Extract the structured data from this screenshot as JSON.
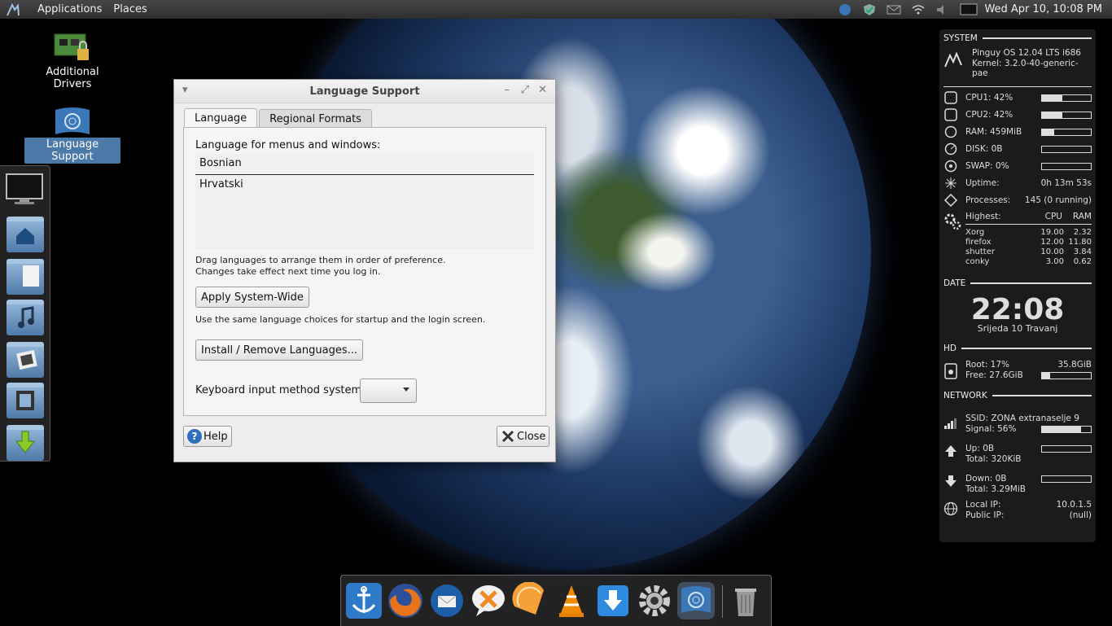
{
  "top_panel": {
    "applications": "Applications",
    "places": "Places",
    "clock": "Wed Apr 10, 10:08 PM"
  },
  "desktop": {
    "icons": [
      {
        "label": "Additional Drivers"
      },
      {
        "label": "Language Support"
      }
    ]
  },
  "window": {
    "title": "Language Support",
    "tabs": [
      "Language",
      "Regional Formats"
    ],
    "language_label": "Language for menus and windows:",
    "languages": [
      "Bosnian",
      "Hrvatski"
    ],
    "hint_line1": "Drag languages to arrange them in order of preference.",
    "hint_line2": "Changes take effect next time you log in.",
    "apply_button": "Apply System-Wide",
    "apply_hint": "Use the same language choices for startup and the login screen.",
    "install_button": "Install / Remove Languages...",
    "keyboard_label": "Keyboard input method system:",
    "help_button": "Help",
    "close_button": "Close"
  },
  "conky": {
    "system_header": "SYSTEM",
    "os": "Pinguy OS 12.04 LTS i686",
    "kernel": "Kernel: 3.2.0-40-generic-pae",
    "cpu1": "CPU1: 42%",
    "cpu1_value": 42,
    "cpu2": "CPU2: 42%",
    "cpu2_value": 42,
    "ram": "RAM: 459MiB",
    "ram_value": 25,
    "disk": "DISK: 0B",
    "swap": "SWAP: 0%",
    "uptime_label": "Uptime:",
    "uptime_value": "0h 13m 53s",
    "processes_label": "Processes:",
    "processes_value": "145 (0 running)",
    "highest_label": "Highest:",
    "cpu_col": "CPU",
    "ram_col": "RAM",
    "top_procs": [
      {
        "name": "Xorg",
        "cpu": "19.00",
        "ram": "2.32"
      },
      {
        "name": "firefox",
        "cpu": "12.00",
        "ram": "11.80"
      },
      {
        "name": "shutter",
        "cpu": "10.00",
        "ram": "3.84"
      },
      {
        "name": "conky",
        "cpu": "3.00",
        "ram": "0.62"
      }
    ],
    "date_header": "DATE",
    "time": "22:08",
    "date": "Srijeda 10 Travanj",
    "hd_header": "HD",
    "root": "Root: 17%",
    "root_size": "35.8GiB",
    "free": "Free: 27.6GiB",
    "root_value": 17,
    "network_header": "NETWORK",
    "ssid": "SSID: ZONA extranaselje 9",
    "signal": "Signal: 56%",
    "signal_value": 80,
    "up": "Up: 0B",
    "up_total": "Total: 320KiB",
    "down": "Down: 0B",
    "down_total": "Total: 3.29MiB",
    "local_ip_label": "Local IP:",
    "local_ip": "10.0.1.5",
    "public_ip_label": "Public IP:",
    "public_ip": "(null)"
  },
  "dock_items": [
    "anchor-icon",
    "firefox-icon",
    "thunderbird-icon",
    "pidgin-icon",
    "orange-icon",
    "vlc-icon",
    "download-icon",
    "settings-icon",
    "language-support-icon",
    "trash-icon"
  ]
}
